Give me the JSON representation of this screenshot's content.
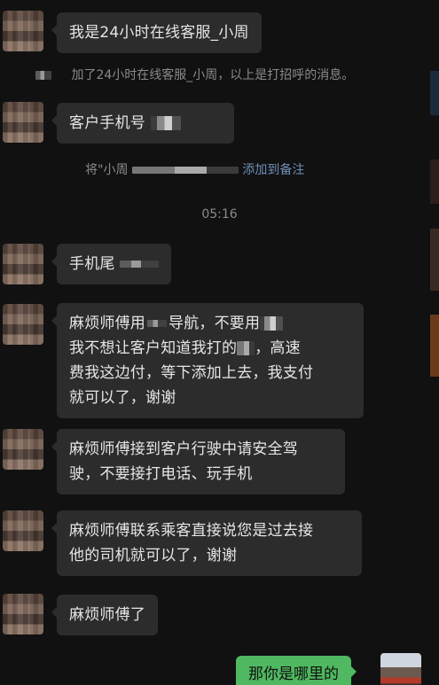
{
  "chat": {
    "messages": [
      {
        "text": "我是24小时在线客服_小周"
      },
      {
        "text_prefix": "客户手机号"
      },
      {
        "text_prefix": "手机尾"
      },
      {
        "line1_a": "麻烦师傅用",
        "line1_b": "导航，不要用",
        "line2_a": "我不想让客户知道我打的",
        "line2_b": "，高速",
        "line3": "费我这边付，等下添加上去，我支付",
        "line4": "就可以了，谢谢"
      },
      {
        "line1": "麻烦师傅接到客户行驶中请安全驾",
        "line2": "驶，不要接打电话、玩手机"
      },
      {
        "line1": "麻烦师傅联系乘客直接说您是过去接",
        "line2": "他的司机就可以了，谢谢"
      },
      {
        "text": "麻烦师傅了"
      }
    ],
    "system_added": "加了24小时在线客服_小周，以上是打招呼的消息。",
    "remark_prefix": "将\"小周",
    "remark_link": "添加到备注",
    "timestamp": "05:16",
    "self_message": "那你是哪里的"
  },
  "colors": {
    "background": "#111111",
    "incoming_bubble": "#2c2c2c",
    "outgoing_bubble": "#4fb860",
    "link": "#6f8fb8"
  }
}
